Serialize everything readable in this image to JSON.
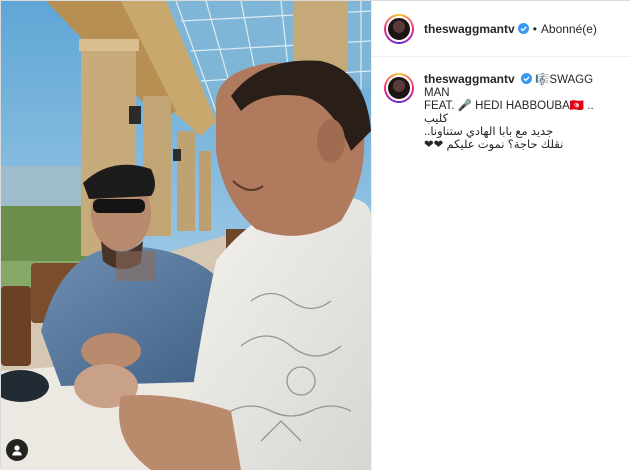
{
  "post": {
    "username": "theswaggmantv",
    "follow_state": "Abonné(e)",
    "separator": "•",
    "caption_line1": "🎼SWAGG MAN",
    "caption_line2": "FEAT. 🎤 HEDI HABBOUBA🇹🇳 .. كليب",
    "caption_line3": "جديد مع بابا الهادي ستناونا..",
    "caption_line4": "نقلك حاجة؟ نموت عليكم ❤❤"
  },
  "icons": {
    "verified": "verified-badge-icon",
    "user_tag": "user-tag-icon"
  },
  "colors": {
    "verified_blue": "#3897f0",
    "text": "#262626",
    "border": "#dbdbdb"
  }
}
